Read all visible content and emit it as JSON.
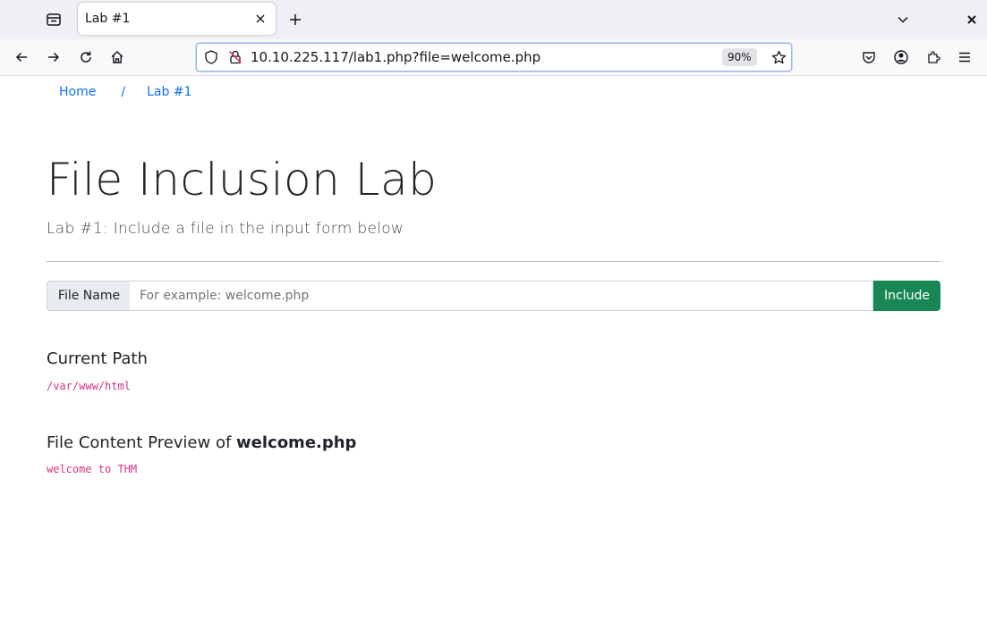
{
  "browser": {
    "tab_title": "Lab #1",
    "url": "10.10.225.117/lab1.php?file=welcome.php",
    "zoom": "90%"
  },
  "breadcrumb": {
    "home": "Home",
    "separator": "/",
    "current": "Lab #1"
  },
  "page": {
    "title": "File Inclusion Lab",
    "subtitle": "Lab #1: Include a file in the input form below"
  },
  "form": {
    "label": "File Name",
    "placeholder": "For example: welcome.php",
    "button": "Include"
  },
  "current_path": {
    "heading": "Current Path",
    "value": "/var/www/html"
  },
  "preview": {
    "heading_prefix": "File Content Preview of ",
    "filename": "welcome.php",
    "content": "welcome to THM"
  },
  "colors": {
    "link": "#0d6efd",
    "button": "#198754",
    "code": "#d63384"
  }
}
